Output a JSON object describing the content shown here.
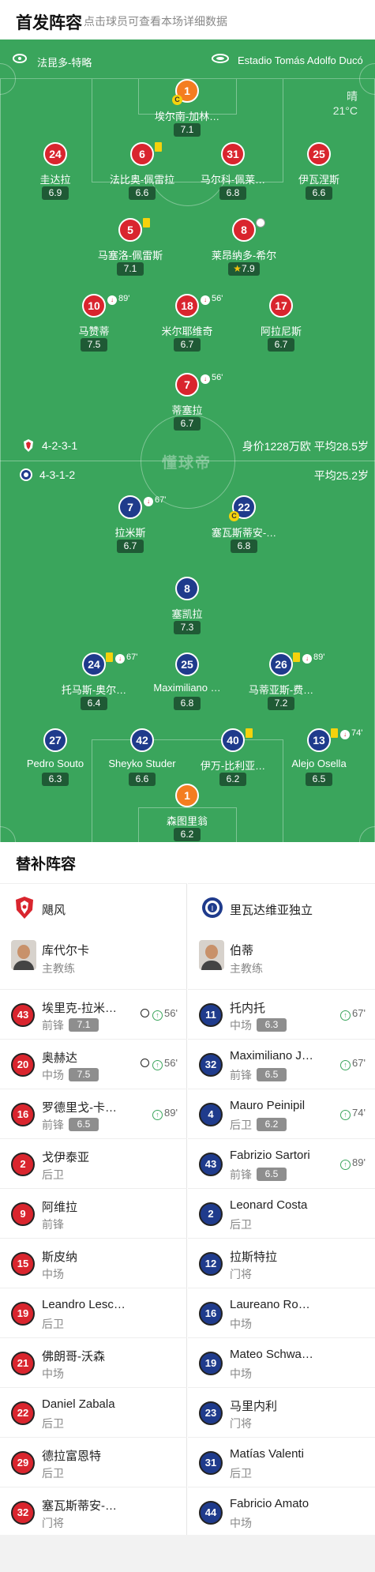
{
  "header": {
    "title": "首发阵容",
    "subtitle": "点击球员可查看本场详细数据"
  },
  "venue": {
    "home_coach_line": "法昆多-特略",
    "stadium": "Estadio Tomás Adolfo Ducó",
    "weather": "晴",
    "temperature": "21°C"
  },
  "home": {
    "formation": "4-2-3-1",
    "value_info": "身价1228万欧 平均28.5岁",
    "color": "#d9252e",
    "players": [
      {
        "num": "1",
        "name": "埃尔南-加林…",
        "rating": "7.1",
        "captain": "C"
      },
      {
        "num": "24",
        "name": "圭达拉",
        "rating": "6.9"
      },
      {
        "num": "6",
        "name": "法比奥-佩雷拉",
        "rating": "6.6"
      },
      {
        "num": "31",
        "name": "马尔科-佩莱…",
        "rating": "6.8"
      },
      {
        "num": "25",
        "name": "伊瓦涅斯",
        "rating": "6.6"
      },
      {
        "num": "5",
        "name": "马塞洛-佩雷斯",
        "rating": "7.1"
      },
      {
        "num": "8",
        "name": "莱昂纳多-希尔",
        "rating": "7.9"
      },
      {
        "num": "10",
        "name": "马赞蒂",
        "rating": "7.5",
        "sub": "89'"
      },
      {
        "num": "18",
        "name": "米尔耶维奇",
        "rating": "6.7",
        "sub": "56'"
      },
      {
        "num": "17",
        "name": "阿拉尼斯",
        "rating": "6.7"
      },
      {
        "num": "7",
        "name": "蒂塞拉",
        "rating": "6.7",
        "sub": "56'"
      }
    ]
  },
  "away": {
    "formation": "4-3-1-2",
    "value_info": "平均25.2岁",
    "color": "#1f3b8c",
    "players": [
      {
        "num": "7",
        "name": "拉米斯",
        "rating": "6.7",
        "sub": "67'"
      },
      {
        "num": "22",
        "name": "塞瓦斯蒂安-…",
        "rating": "6.8",
        "captain": "C"
      },
      {
        "num": "8",
        "name": "塞凯拉",
        "rating": "7.3"
      },
      {
        "num": "24",
        "name": "托马斯-奥尔…",
        "rating": "6.4",
        "sub": "67'"
      },
      {
        "num": "25",
        "name": "Maximiliano …",
        "rating": "6.8"
      },
      {
        "num": "26",
        "name": "马蒂亚斯-费…",
        "rating": "7.2",
        "sub": "89'"
      },
      {
        "num": "27",
        "name": "Pedro Souto",
        "rating": "6.3"
      },
      {
        "num": "42",
        "name": "Sheyko Studer",
        "rating": "6.6"
      },
      {
        "num": "40",
        "name": "伊万-比利亚…",
        "rating": "6.2"
      },
      {
        "num": "13",
        "name": "Alejo Osella",
        "rating": "6.5",
        "sub": "74'"
      },
      {
        "num": "1",
        "name": "森图里翁",
        "rating": "6.2"
      }
    ]
  },
  "bench": {
    "title": "替补阵容",
    "left": {
      "team": "飓风",
      "coach": {
        "name": "库代尔卡",
        "role": "主教练"
      },
      "subs": [
        {
          "num": "43",
          "name": "埃里克-拉米…",
          "pos": "前锋",
          "rating": "7.1",
          "event": "56'"
        },
        {
          "num": "20",
          "name": "奥赫达",
          "pos": "中场",
          "rating": "7.5",
          "event": "56'"
        },
        {
          "num": "16",
          "name": "罗德里戈-卡…",
          "pos": "前锋",
          "rating": "6.5",
          "event": "89'"
        },
        {
          "num": "2",
          "name": "戈伊泰亚",
          "pos": "后卫"
        },
        {
          "num": "9",
          "name": "阿维拉",
          "pos": "前锋"
        },
        {
          "num": "15",
          "name": "斯皮纳",
          "pos": "中场"
        },
        {
          "num": "19",
          "name": "Leandro Lesc…",
          "pos": "后卫"
        },
        {
          "num": "21",
          "name": "佛朗哥-沃森",
          "pos": "中场"
        },
        {
          "num": "22",
          "name": "Daniel Zabala",
          "pos": "后卫"
        },
        {
          "num": "29",
          "name": "德拉富恩特",
          "pos": "后卫"
        },
        {
          "num": "32",
          "name": "塞瓦斯蒂安-…",
          "pos": "门将"
        }
      ]
    },
    "right": {
      "team": "里瓦达维亚独立",
      "coach": {
        "name": "伯蒂",
        "role": "主教练"
      },
      "subs": [
        {
          "num": "11",
          "name": "托内托",
          "pos": "中场",
          "rating": "6.3",
          "event": "67'"
        },
        {
          "num": "32",
          "name": "Maximiliano J…",
          "pos": "前锋",
          "rating": "6.5",
          "event": "67'"
        },
        {
          "num": "4",
          "name": "Mauro Peinipil",
          "pos": "后卫",
          "rating": "6.2",
          "event": "74'"
        },
        {
          "num": "43",
          "name": "Fabrizio Sartori",
          "pos": "前锋",
          "rating": "6.5",
          "event": "89'"
        },
        {
          "num": "2",
          "name": "Leonard Costa",
          "pos": "后卫"
        },
        {
          "num": "12",
          "name": "拉斯特拉",
          "pos": "门将"
        },
        {
          "num": "16",
          "name": "Laureano Ro…",
          "pos": "中场"
        },
        {
          "num": "19",
          "name": "Mateo Schwa…",
          "pos": "中场"
        },
        {
          "num": "23",
          "name": "马里内利",
          "pos": "门将"
        },
        {
          "num": "31",
          "name": "Matías Valenti",
          "pos": "后卫"
        },
        {
          "num": "44",
          "name": "Fabricio Amato",
          "pos": "中场"
        }
      ]
    }
  }
}
